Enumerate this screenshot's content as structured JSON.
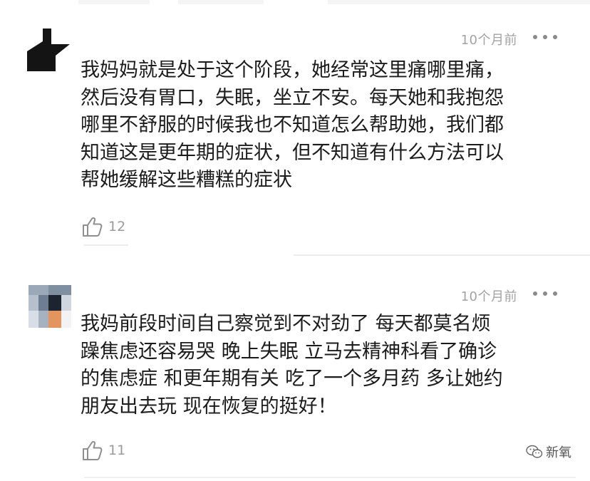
{
  "comments": [
    {
      "time": "10个月前",
      "lines": [
        "我妈妈就是处于这个阶段，她经常这里痛哪里痛，",
        "然后没有胃口，失眠，坐立不安。每天她和我抱怨",
        "哪里不舒服的时候我也不知道怎么帮助她，我们都",
        "知道这是更年期的症状，但不知道有什么方法可以",
        "帮她缓解这些糟糕的症状"
      ],
      "likes": "12"
    },
    {
      "time": "10个月前",
      "lines": [
        "我妈前段时间自己察觉到不对劲了 每天都莫名烦",
        "躁焦虑还容易哭 晚上失眠 立马去精神科看了确诊",
        "的焦虑症 和更年期有关 吃了一个多月药 多让她约",
        "朋友出去玩 现在恢复的挺好！"
      ],
      "likes": "11"
    }
  ],
  "icons": {
    "like": "thumbs-up-icon",
    "more": "more-dots-icon",
    "watermark": "wechat-icon"
  },
  "watermark": {
    "label": "新氧"
  }
}
